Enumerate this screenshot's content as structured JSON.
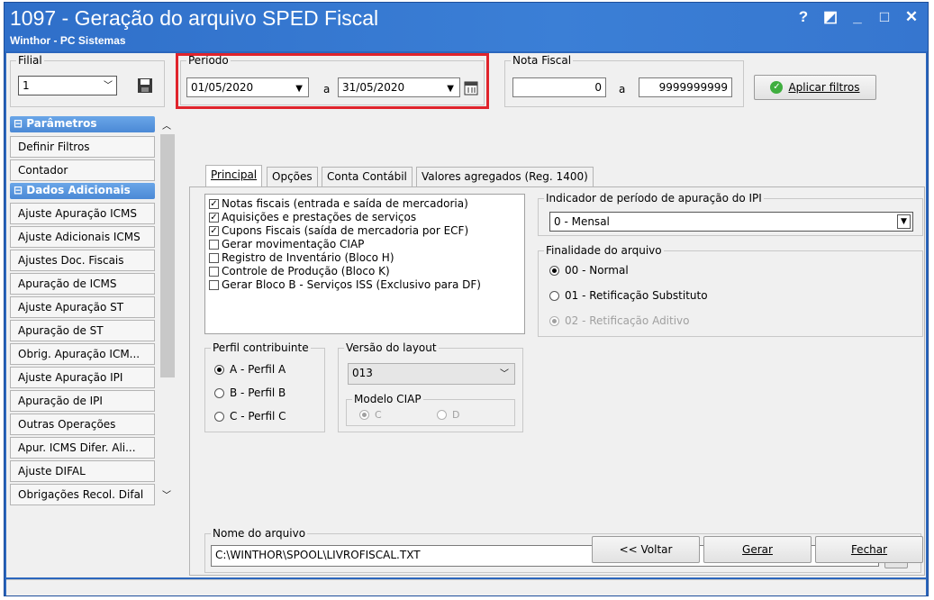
{
  "window": {
    "title": "1097 - Geração do arquivo SPED Fiscal",
    "subtitle": "Winthor - PC Sistemas",
    "controls": [
      "?",
      "◩",
      "_",
      "□",
      "✕"
    ]
  },
  "filial": {
    "label": "Filial",
    "value": "1"
  },
  "periodo": {
    "label": "Período",
    "start": "01/05/2020",
    "separator": "a",
    "end": "31/05/2020"
  },
  "nota_fiscal": {
    "label": "Nota Fiscal",
    "start": "0",
    "separator": "a",
    "end": "9999999999"
  },
  "apply_button": {
    "label": "Aplicar filtros"
  },
  "sidebar": {
    "sections": [
      {
        "title": "Parâmetros",
        "items": [
          "Definir Filtros",
          "Contador"
        ]
      },
      {
        "title": "Dados Adicionais",
        "items": [
          "Ajuste Apuração ICMS",
          "Ajuste Adicionais ICMS",
          "Ajustes Doc. Fiscais",
          "Apuração de ICMS",
          "Ajuste Apuração ST",
          "Apuração de ST",
          "Obrig. Apuração ICM...",
          "Ajuste Apuração IPI",
          "Apuração de IPI",
          "Outras Operações",
          "Apur. ICMS Difer. Ali...",
          "Ajuste DIFAL",
          "Obrigações Recol. Difal"
        ]
      }
    ]
  },
  "tabs": [
    "Principal",
    "Opções",
    "Conta Contábil",
    "Valores agregados (Reg. 1400)"
  ],
  "checklist": [
    {
      "label": "Notas fiscais (entrada e saída de mercadoria)",
      "checked": true
    },
    {
      "label": "Aquisições e prestações de serviços",
      "checked": true
    },
    {
      "label": "Cupons Fiscais (saída de mercadoria por ECF)",
      "checked": true
    },
    {
      "label": "Gerar movimentação CIAP",
      "checked": false
    },
    {
      "label": "Registro de Inventário (Bloco H)",
      "checked": false
    },
    {
      "label": "Controle de Produção (Bloco K)",
      "checked": false
    },
    {
      "label": "Gerar Bloco B - Serviços ISS (Exclusivo para DF)",
      "checked": false
    }
  ],
  "ipi": {
    "label": "Indicador de período de apuração do IPI",
    "value": "0 - Mensal"
  },
  "finalidade": {
    "label": "Finalidade do arquivo",
    "options": [
      {
        "label": "00 - Normal",
        "selected": true,
        "disabled": false
      },
      {
        "label": "01 - Retificação Substituto",
        "selected": false,
        "disabled": false
      },
      {
        "label": "02 - Retificação Aditivo",
        "selected": true,
        "disabled": true
      }
    ]
  },
  "perfil": {
    "label": "Perfil contribuinte",
    "options": [
      {
        "label": "A - Perfil A",
        "selected": true
      },
      {
        "label": "B - Perfil B",
        "selected": false
      },
      {
        "label": "C - Perfil C",
        "selected": false
      }
    ]
  },
  "versao": {
    "label": "Versão do layout",
    "value": "013"
  },
  "ciap": {
    "label": "Modelo CIAP",
    "options": [
      "C",
      "D"
    ],
    "selected": "C"
  },
  "nome_arquivo": {
    "label": "Nome do arquivo",
    "value": "C:\\WINTHOR\\SPOOL\\LIVROFISCAL.TXT"
  },
  "buttons": {
    "voltar": "<< Voltar",
    "gerar": "Gerar",
    "fechar": "Fechar"
  },
  "highlight_color": "#e0242c"
}
